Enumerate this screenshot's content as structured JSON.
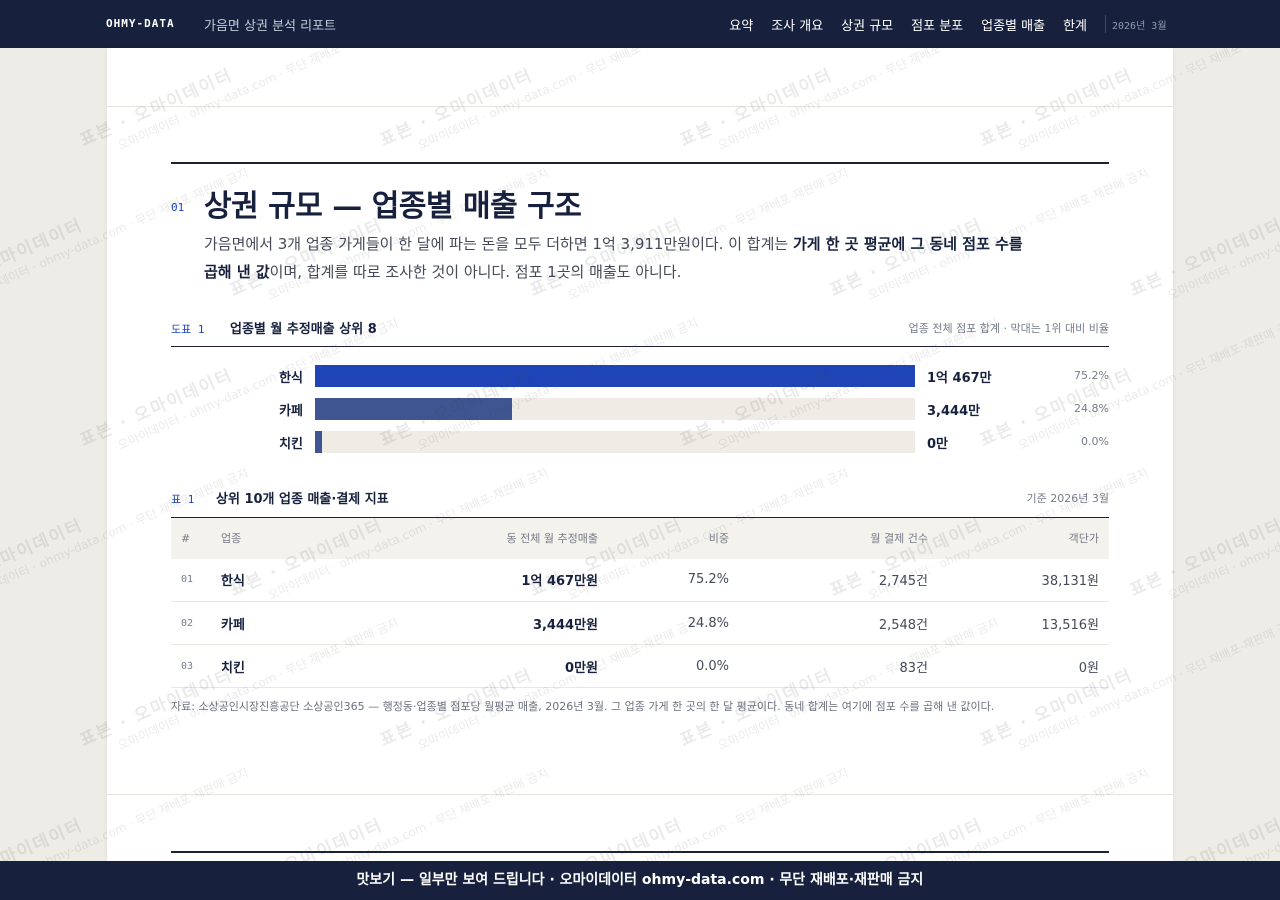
{
  "header": {
    "brand": "OHMY-DATA",
    "subtitle": "가음면 상권 분석 리포트",
    "nav": [
      "요약",
      "조사 개요",
      "상권 규모",
      "점포 분포",
      "업종별 매출",
      "한계"
    ],
    "issue": "2026년 3월"
  },
  "section": {
    "number": "01",
    "title": "상권 규모 — 업종별 매출 구조",
    "lead_1": "가음면에서 3개 업종 가게들이 한 달에 파는 돈을 모두 더하면 1억 3,911만원이다. 이 합계는 ",
    "lead_bold": "가게 한 곳 평균에 그 동네 점포 수를 곱해 낸 값",
    "lead_2": "이며, 합계를 따로 조사한 것이 아니다. 점포 1곳의 매출도 아니다."
  },
  "figure": {
    "kicker": "도표 1",
    "title": "업종별 월 추정매출 상위 8",
    "note": "업종 전체 점포 합계 · 막대는 1위 대비 비율"
  },
  "chart_data": {
    "type": "bar",
    "orientation": "horizontal",
    "categories": [
      "한식",
      "카페",
      "치킨"
    ],
    "values": [
      10467,
      3444,
      0
    ],
    "value_labels": [
      "1억 467만",
      "3,444만",
      "0만"
    ],
    "shares": [
      "75.2%",
      "24.8%",
      "0.0%"
    ],
    "colors": [
      "#1e44b8",
      "#3f5591",
      "#3f5591"
    ]
  },
  "table": {
    "kicker": "표 1",
    "title": "상위 10개 업종 매출·결제 지표",
    "note": "기준 2026년 3월",
    "columns": [
      "#",
      "업종",
      "동 전체 월 추정매출",
      "비중",
      "월 결제 건수",
      "객단가"
    ],
    "rows": [
      [
        "01",
        "한식",
        "1억 467만원",
        "75.2%",
        "2,745건",
        "38,131원"
      ],
      [
        "02",
        "카페",
        "3,444만원",
        "24.8%",
        "2,548건",
        "13,516원"
      ],
      [
        "03",
        "치킨",
        "0만원",
        "0.0%",
        "83건",
        "0원"
      ]
    ]
  },
  "source": "자료: 소상공인시장진흥공단 소상공인365 — 행정동·업종별 점포당 월평균 매출, 2026년 3월. 그 업종 가게 한 곳의 한 달 평균이다. 동네 합계는 여기에 점포 수를 곱해 낸 값이다.",
  "watermark": {
    "primary": "표본 · 오마이데이터",
    "secondary": "오마이데이터 · ohmy-data.com · 무단 재배포·재판매 금지"
  },
  "footer": "맛보기 — 일부만 보여 드립니다 · 오마이데이터 ohmy-data.com · 무단 재배포·재판매 금지",
  "colors": {
    "navy": "#17213d",
    "accent": "#1f45b8",
    "bar_primary": "#1e44b8",
    "bar_secondary": "#3f5591"
  }
}
